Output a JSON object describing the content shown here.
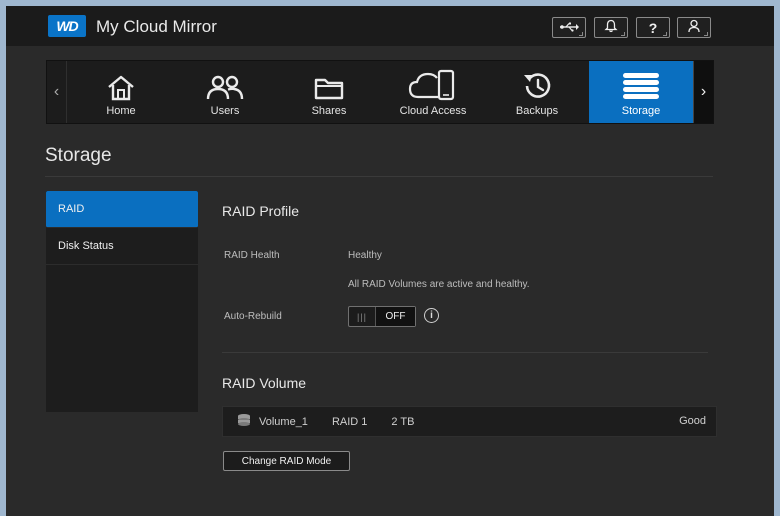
{
  "header": {
    "logo_text": "WD",
    "app_title": "My Cloud Mirror",
    "buttons": [
      {
        "name": "usb-icon"
      },
      {
        "name": "bell-icon"
      },
      {
        "name": "help-icon",
        "label": "?"
      },
      {
        "name": "user-icon"
      }
    ]
  },
  "nav": {
    "items": [
      {
        "label": "Home",
        "icon": "home-icon"
      },
      {
        "label": "Users",
        "icon": "users-icon"
      },
      {
        "label": "Shares",
        "icon": "folder-icon"
      },
      {
        "label": "Cloud Access",
        "icon": "cloud-device-icon"
      },
      {
        "label": "Backups",
        "icon": "history-icon"
      },
      {
        "label": "Storage",
        "icon": "storage-icon",
        "active": true
      }
    ]
  },
  "page": {
    "title": "Storage"
  },
  "sidebar": {
    "items": [
      {
        "label": "RAID",
        "active": true
      },
      {
        "label": "Disk Status"
      }
    ]
  },
  "raid_profile": {
    "title": "RAID Profile",
    "health_label": "RAID Health",
    "health_value": "Healthy",
    "health_detail": "All RAID Volumes are active and healthy.",
    "auto_rebuild_label": "Auto-Rebuild",
    "auto_rebuild_grip": "|||",
    "auto_rebuild_state": "OFF",
    "info_icon_glyph": "i"
  },
  "raid_volume": {
    "title": "RAID Volume",
    "volume": {
      "name": "Volume_1",
      "raid_level": "RAID 1",
      "size": "2 TB",
      "status": "Good"
    },
    "change_button": "Change RAID Mode"
  },
  "colors": {
    "accent": "#0a6fc0",
    "background": "#2a2a2a",
    "panel": "#1d1d1d"
  }
}
